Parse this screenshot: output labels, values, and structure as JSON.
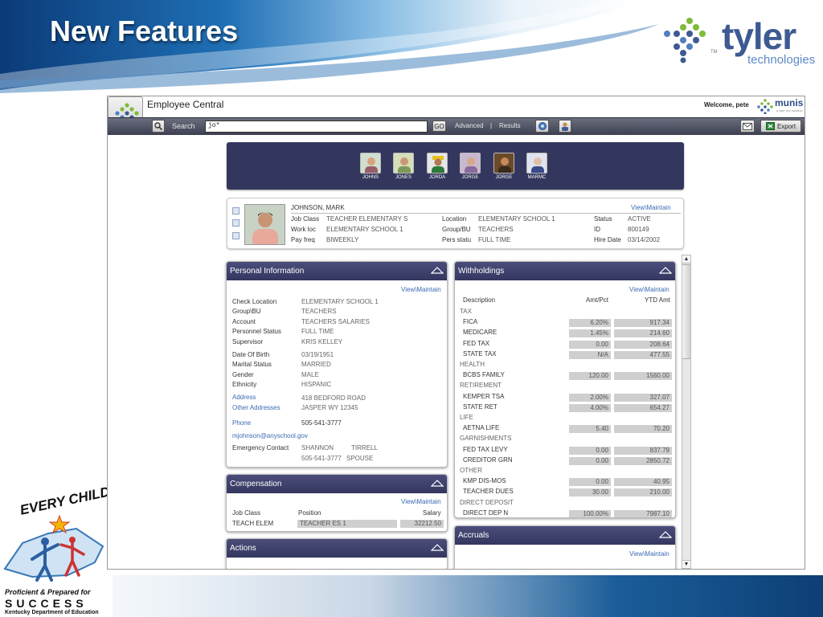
{
  "slide": {
    "title": "New Features"
  },
  "brand": {
    "tyler_word": "tyler",
    "tyler_sub": "technologies",
    "tm": "TM"
  },
  "kde": {
    "every_child": "EVERY CHILD",
    "line1": "Proficient & Prepared for",
    "line2": "SUCCESS",
    "line3": "Kentucky Department of Education"
  },
  "app": {
    "title": "Employee Central",
    "welcome": "Welcome, pete",
    "munis_word": "munis",
    "munis_sub": "a tyler erp solution",
    "toolbar": {
      "search_label": "Search",
      "search_value": "jo*",
      "go_label": "GO",
      "advanced_label": "Advanced",
      "separator": "|",
      "results_label": "Results",
      "export_label": "Export"
    }
  },
  "thumbnails": [
    "JOHNS",
    "JONES",
    "JORDA",
    "JORGE",
    "JORGE",
    "MARMC"
  ],
  "summary": {
    "name": "JOHNSON, MARK",
    "view_link": "View\\Maintain",
    "fields": [
      {
        "label": "Job Class",
        "value": "TEACHER ELEMENTARY S"
      },
      {
        "label": "Work loc",
        "value": "ELEMENTARY SCHOOL 1"
      },
      {
        "label": "Pay freq",
        "value": "BIWEEKLY"
      },
      {
        "label": "Location",
        "value": "ELEMENTARY SCHOOL 1"
      },
      {
        "label": "Group/BU",
        "value": "TEACHERS"
      },
      {
        "label": "Pers statu",
        "value": "FULL TIME"
      },
      {
        "label": "Status",
        "value": "ACTIVE"
      },
      {
        "label": "ID",
        "value": "800149"
      },
      {
        "label": "Hire Date",
        "value": "03/14/2002"
      }
    ]
  },
  "personal": {
    "title": "Personal Information",
    "view_link": "View\\Maintain",
    "rows": [
      {
        "label": "Check Location",
        "value": "ELEMENTARY SCHOOL 1"
      },
      {
        "label": "Group\\BU",
        "value": "TEACHERS"
      },
      {
        "label": "Account",
        "value": "TEACHERS SALARIES"
      },
      {
        "label": "Personnel Status",
        "value": "FULL TIME"
      },
      {
        "label": "Supervisor",
        "value": "KRIS KELLEY"
      },
      {
        "label": "Date Of Birth",
        "value": "03/19/1951"
      },
      {
        "label": "Marital Status",
        "value": "MARRIED"
      },
      {
        "label": "Gender",
        "value": "MALE"
      },
      {
        "label": "Ethnicity",
        "value": "HISPANIC"
      }
    ],
    "address_label": "Address",
    "address_line1": "418 BEDFORD ROAD",
    "other_addresses_label": "Other Addresses",
    "address_line2": "JASPER  WY  12345",
    "phone_label": "Phone",
    "phone_value": "505-541-3777",
    "email": "mjohnson@anyschool.gov",
    "emergency_label": "Emergency Contact",
    "emergency_first": "SHANNON",
    "emergency_last": "TIRRELL",
    "emergency_phone": "505-541-3777",
    "emergency_relation": "SPOUSE"
  },
  "compensation": {
    "title": "Compensation",
    "view_link": "View\\Maintain",
    "headers": [
      "Job Class",
      "Position",
      "Salary"
    ],
    "row": {
      "job_class": "TEACH ELEM",
      "position": "TEACHER ES 1",
      "salary": "32212.50"
    }
  },
  "actions": {
    "title": "Actions"
  },
  "withholdings": {
    "title": "Withholdings",
    "view_link": "View\\Maintain",
    "headers": [
      "Description",
      "Amt/Pct",
      "YTD Amt"
    ],
    "rows": [
      {
        "type": "group",
        "label": "TAX"
      },
      {
        "type": "item",
        "label": "FICA",
        "amt": "6.20%",
        "ytd": "917.34"
      },
      {
        "type": "item",
        "label": "MEDICARE",
        "amt": "1.45%",
        "ytd": "214.60"
      },
      {
        "type": "item",
        "label": "FED TAX",
        "amt": "0.00",
        "ytd": "208.64"
      },
      {
        "type": "item",
        "label": "STATE TAX",
        "amt": "N/A",
        "ytd": "477.55"
      },
      {
        "type": "group",
        "label": "HEALTH"
      },
      {
        "type": "item",
        "label": "BCBS FAMILY",
        "amt": "120.00",
        "ytd": "1560.00"
      },
      {
        "type": "group",
        "label": "RETIREMENT"
      },
      {
        "type": "item",
        "label": "KEMPER TSA",
        "amt": "2.00%",
        "ytd": "327.07"
      },
      {
        "type": "item",
        "label": "STATE RET",
        "amt": "4.00%",
        "ytd": "654.27"
      },
      {
        "type": "group",
        "label": "LIFE"
      },
      {
        "type": "item",
        "label": "AETNA LIFE",
        "amt": "5.40",
        "ytd": "70.20"
      },
      {
        "type": "group",
        "label": "GARNISHMENTS"
      },
      {
        "type": "item",
        "label": "FED TAX LEVY",
        "amt": "0.00",
        "ytd": "837.79"
      },
      {
        "type": "item",
        "label": "CREDITOR GRN",
        "amt": "0.00",
        "ytd": "2850.72"
      },
      {
        "type": "group",
        "label": "OTHER"
      },
      {
        "type": "item",
        "label": "KMP DIS-MOS",
        "amt": "0.00",
        "ytd": "40.95"
      },
      {
        "type": "item",
        "label": "TEACHER DUES",
        "amt": "30.00",
        "ytd": "210.00"
      },
      {
        "type": "group",
        "label": "DIRECT DEPOSIT"
      },
      {
        "type": "item",
        "label": "DIRECT DEP N",
        "amt": "100.00%",
        "ytd": "7987.10"
      }
    ]
  },
  "accruals": {
    "title": "Accruals",
    "view_link": "View\\Maintain"
  },
  "colors": {
    "panel_header": "#34375f",
    "link": "#3a6ab0",
    "accent_blue": "#3e5a93"
  }
}
